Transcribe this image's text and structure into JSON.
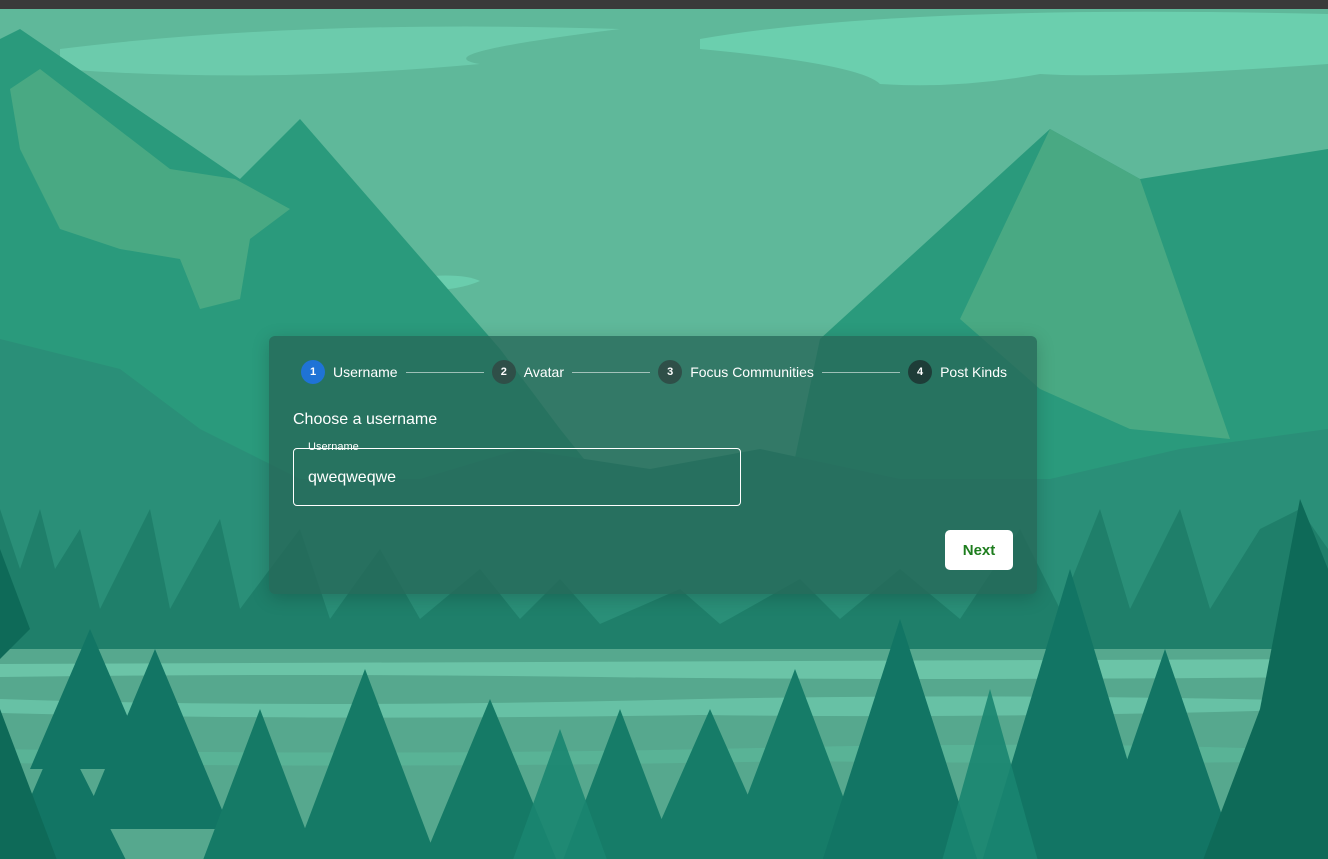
{
  "stepper": {
    "steps": [
      {
        "number": "1",
        "label": "Username",
        "active": true
      },
      {
        "number": "2",
        "label": "Avatar",
        "active": false
      },
      {
        "number": "3",
        "label": "Focus Communities",
        "active": false
      },
      {
        "number": "4",
        "label": "Post Kinds",
        "active": false
      }
    ]
  },
  "form": {
    "title": "Choose a username",
    "username_label": "Username",
    "username_value": "qweqweqwe"
  },
  "actions": {
    "next_label": "Next"
  },
  "colors": {
    "active_step": "#1f73d6",
    "next_text": "#1e7d1e",
    "card_bg": "rgba(38,104,88,0.78)"
  }
}
